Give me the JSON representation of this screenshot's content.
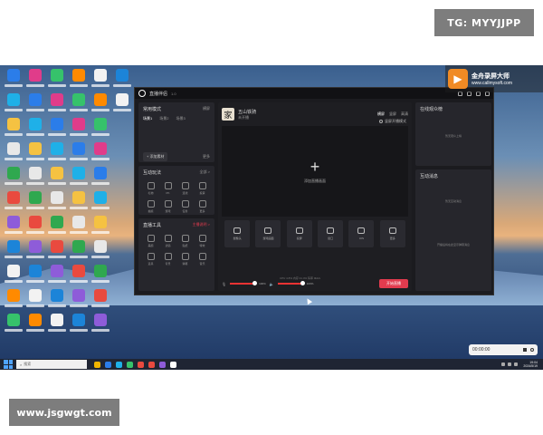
{
  "watermark": {
    "tag": "TG: MYYJJPP",
    "site": "www.jsgwgt.com"
  },
  "recorder": {
    "brand": "金舟录屏大师",
    "url": "www.callmysoft.com",
    "timer": "00:00:00"
  },
  "colors": {
    "accent": "#e23b4e",
    "app_bg": "#1b1b1f"
  },
  "app": {
    "title": "直播伴侣",
    "version": "1.0",
    "left_a": {
      "title": "常用模式",
      "tag": "横屏",
      "scene_label": "场景1",
      "scene_items": [
        "场景2",
        "场景3"
      ],
      "add_scene": "+ 添加素材",
      "more": "更多"
    },
    "left_b": {
      "title": "互动玩法",
      "more": "全部 >",
      "tiles": [
        "礼物",
        "PK",
        "连线",
        "投票",
        "抽奖",
        "游戏",
        "任务",
        "更多"
      ]
    },
    "left_c": {
      "title": "直播工具",
      "hint": "主播说明 >",
      "tiles": [
        "美颜",
        "滤镜",
        "贴纸",
        "特效",
        "道具",
        "背景",
        "弹幕",
        "音乐"
      ]
    },
    "center": {
      "avatar_char": "家",
      "host_name": "五山铁骑",
      "host_sub": "未开播",
      "tabs": [
        "横屏",
        "竖屏",
        "高清"
      ],
      "landscape_label": "竖屏开播模式",
      "add_source": "添加直播画面",
      "tools": [
        "摄像头",
        "游戏画面",
        "投屏",
        "窗口",
        "iOS",
        "更多"
      ],
      "vol1": "100%",
      "vol2": "100%",
      "go_live": "开始直播",
      "status": "CPU 4.8%   内存 31.4%   码率 0kb/s"
    },
    "right_a": {
      "title": "在线观众榜",
      "hint": "暂无观众上榜"
    },
    "right_b": {
      "title": "互动消息",
      "hint1": "暂无互动消息",
      "hint2": "开播后将在此显示弹幕消息"
    }
  },
  "taskbar": {
    "search_placeholder": "搜索",
    "time": "19:04",
    "date": "2024/5/19"
  }
}
